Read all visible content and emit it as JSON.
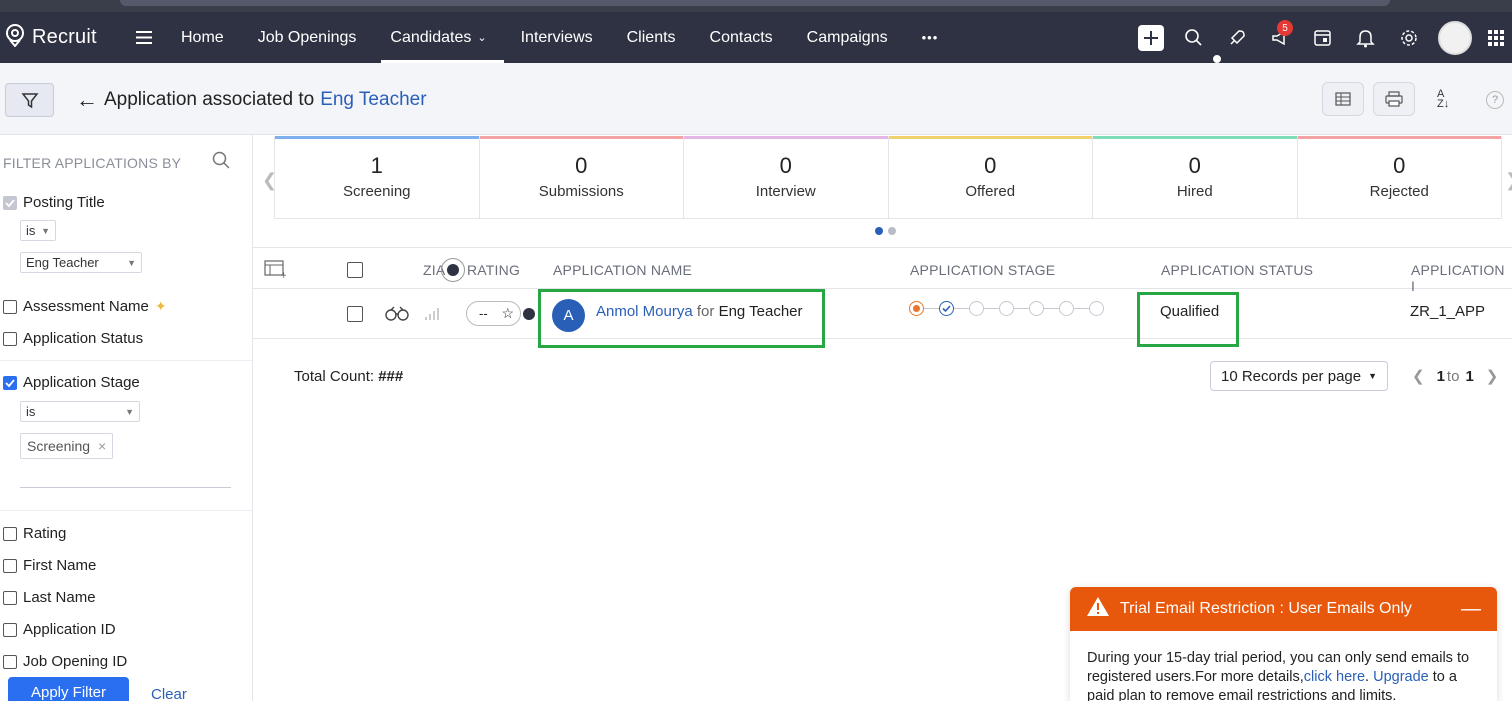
{
  "app": {
    "name": "Recruit"
  },
  "nav": {
    "items": [
      "Home",
      "Job Openings",
      "Candidates",
      "Interviews",
      "Clients",
      "Contacts",
      "Campaigns"
    ],
    "more": "•••",
    "notification_count": "5"
  },
  "header": {
    "back_arrow": "←",
    "title_prefix": "Application associated to",
    "title_link": "Eng Teacher"
  },
  "sidebar": {
    "heading": "FILTER APPLICATIONS BY",
    "posting_title": {
      "label": "Posting Title",
      "operator": "is",
      "value": "Eng Teacher"
    },
    "assessment_name": "Assessment Name",
    "application_status": "Application Status",
    "application_stage": {
      "label": "Application Stage",
      "operator": "is",
      "chip": "Screening",
      "chip_remove": "×"
    },
    "fields": [
      "Rating",
      "First Name",
      "Last Name",
      "Application ID",
      "Job Opening ID"
    ],
    "apply_label": "Apply Filter",
    "clear_label": "Clear"
  },
  "stages": [
    {
      "count": "1",
      "label": "Screening",
      "color": "#7fb0ee"
    },
    {
      "count": "0",
      "label": "Submissions",
      "color": "#f3a3a3"
    },
    {
      "count": "0",
      "label": "Interview",
      "color": "#e4b8e4"
    },
    {
      "count": "0",
      "label": "Offered",
      "color": "#f0d26a"
    },
    {
      "count": "0",
      "label": "Hired",
      "color": "#7fdcb8"
    },
    {
      "count": "0",
      "label": "Rejected",
      "color": "#f3a3a3"
    }
  ],
  "table": {
    "headers": {
      "zia": "ZIA",
      "rating": "RATING",
      "name": "APPLICATION NAME",
      "stage": "APPLICATION STAGE",
      "status": "APPLICATION STATUS",
      "id": "APPLICATION I"
    },
    "row": {
      "rating": "--",
      "avatar_letter": "A",
      "candidate": "Anmol Mourya",
      "for_word": "for",
      "job": "Eng Teacher",
      "status": "Qualified",
      "app_id": "ZR_1_APP"
    }
  },
  "footer": {
    "total_label": "Total Count:",
    "total_value": "###",
    "per_page": "10 Records per page",
    "page_from": "1",
    "page_to_word": "to",
    "page_to": "1"
  },
  "toast": {
    "title": "Trial Email Restriction : User Emails Only",
    "body_1": "During your 15-day trial period, you can only send emails to registered users.For more details,",
    "link_1": "click here",
    "body_2": ". ",
    "link_2": "Upgrade",
    "body_3": " to a paid plan to remove email restrictions and limits.",
    "minimize": "—"
  }
}
